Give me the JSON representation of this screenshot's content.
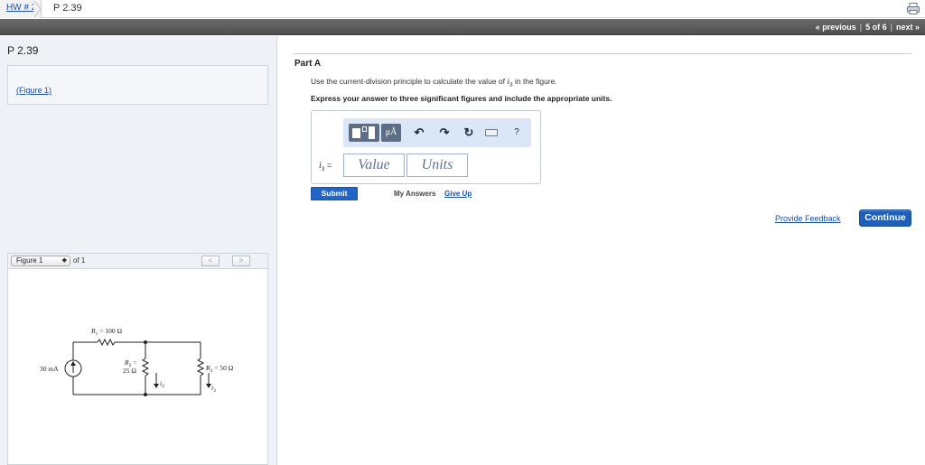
{
  "breadcrumb": {
    "assignment": "HW # 2",
    "current": "P 2.39"
  },
  "nav": {
    "previous": "« previous",
    "position": "5 of 6",
    "next": "next »"
  },
  "problem": {
    "title": "P 2.39",
    "figure_link": "(Figure 1)"
  },
  "figure_panel": {
    "selected": "Figure 1",
    "of_label": "of 1",
    "prev": "<",
    "next": ">",
    "circuit": {
      "source": "30 mA",
      "r1": "R",
      "r1_sub": "1",
      "r1_val": " = 100 Ω",
      "r2": "R",
      "r2_sub": "2",
      "r2_eq": " =",
      "r2_val": "25 Ω",
      "r3": "R",
      "r3_sub": "3",
      "r3_val": " = 50 Ω",
      "i2": "i",
      "i2_sub": "2",
      "i3": "i",
      "i3_sub": "3"
    }
  },
  "part": {
    "title": "Part A",
    "instruction_pre": "Use the current-division principle to calculate the value of ",
    "instruction_var": "i",
    "instruction_sub": "3",
    "instruction_post": " in the figure.",
    "express": "Express your answer to three significant figures and include the appropriate units."
  },
  "toolbar": {
    "units_label": "μÅ",
    "undo": "↶",
    "redo": "↷",
    "reset": "↻",
    "help": "?"
  },
  "answer": {
    "var": "i",
    "var_sub": "3",
    "eq": " =",
    "value_placeholder": "Value",
    "units_placeholder": "Units"
  },
  "actions": {
    "submit": "Submit",
    "my_answers": "My Answers",
    "give_up": "Give Up",
    "feedback": "Provide Feedback",
    "continue": "Continue"
  },
  "colors": {
    "accent": "#2166c7",
    "link": "#1a4fa8",
    "toolbar_bg": "#dbe6f7",
    "navbar": "#555555"
  }
}
